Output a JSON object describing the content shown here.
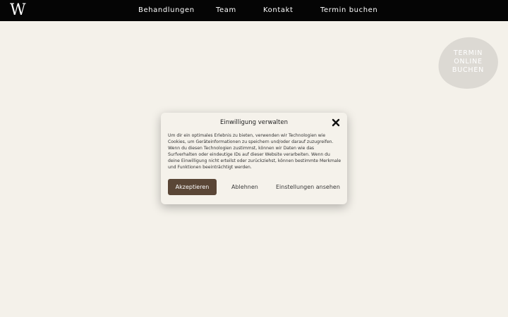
{
  "header": {
    "logo": "W",
    "nav": [
      {
        "label": "Behandlungen"
      },
      {
        "label": "Team"
      },
      {
        "label": "Kontakt"
      },
      {
        "label": "Termin buchen"
      }
    ]
  },
  "booking_badge": {
    "lines": [
      "TERMIN",
      "ONLINE",
      "BUCHEN"
    ]
  },
  "consent_modal": {
    "title": "Einwilligung verwalten",
    "body": "Um dir ein optimales Erlebnis zu bieten, verwenden wir Technologien wie Cookies, um Geräteinformationen zu speichern und/oder darauf zuzugreifen. Wenn du diesen Technologien zustimmst, können wir Daten wie das Surfverhalten oder eindeutige IDs auf dieser Website verarbeiten. Wenn du deine Einwilligung nicht erteilst oder zurückziehst, können bestimmte Merkmale und Funktionen beeinträchtigt werden.",
    "accept_label": "Akzeptieren",
    "deny_label": "Ablehnen",
    "settings_label": "Einstellungen ansehen"
  },
  "colors": {
    "page_background": "#f4f1ea",
    "header_background": "#050505",
    "accept_button": "#5a4636",
    "badge_background": "#dcd9d3"
  }
}
